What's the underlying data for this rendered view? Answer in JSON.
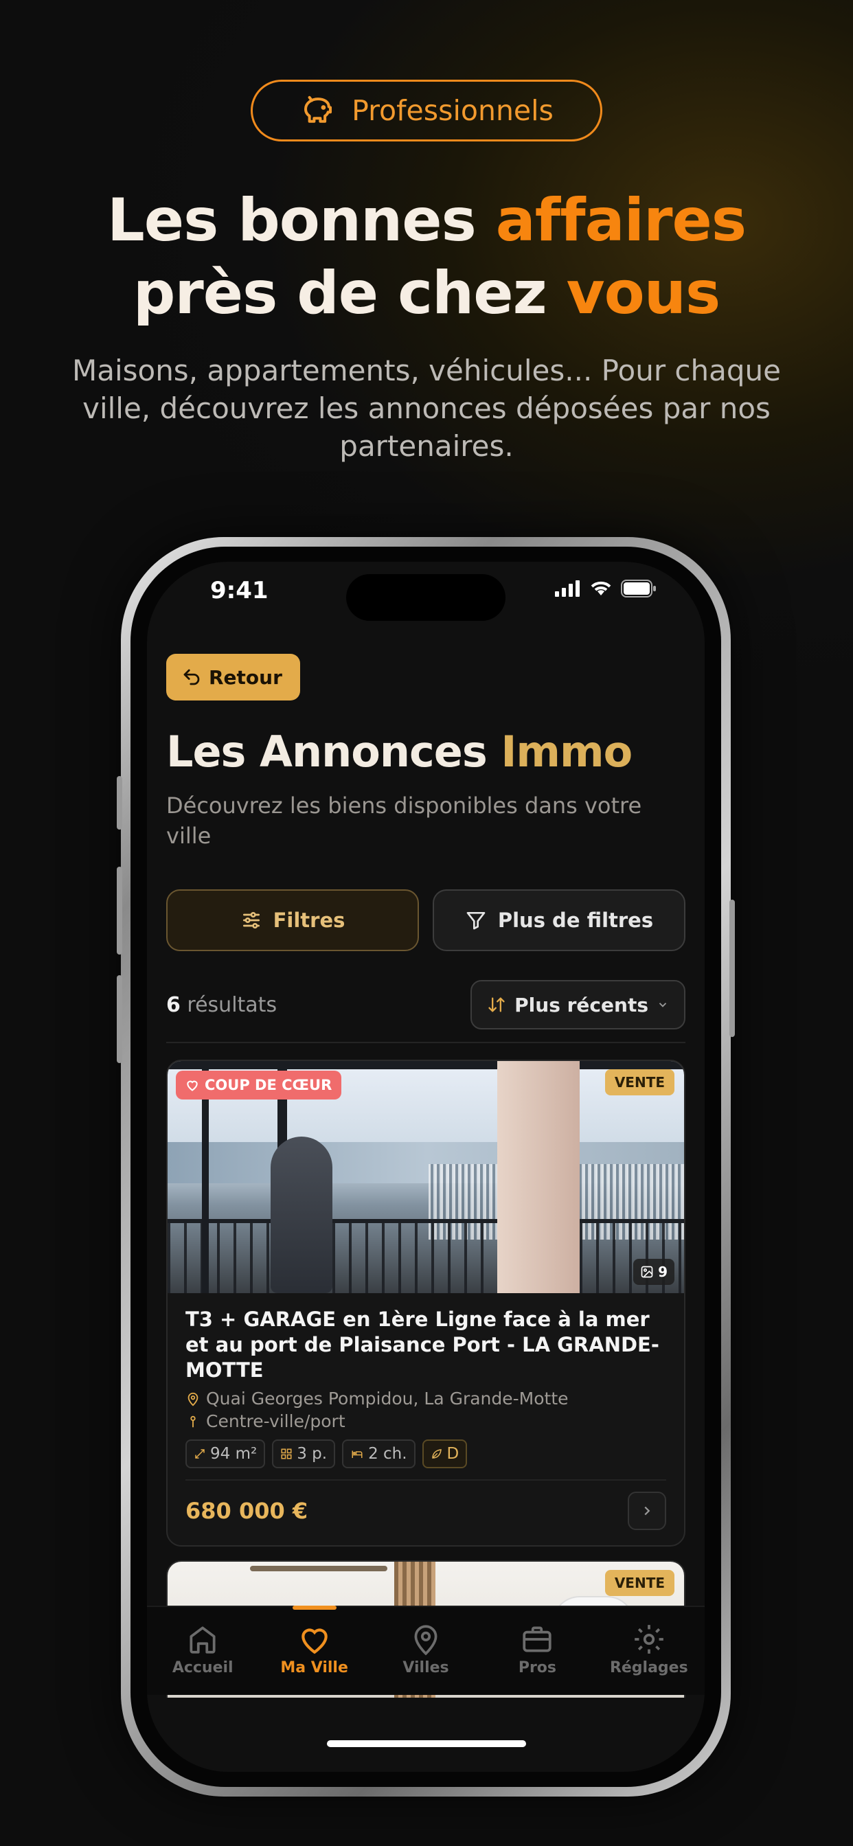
{
  "promo": {
    "badge_label": "Professionnels",
    "headline_part1": "Les bonnes ",
    "headline_accent1": "affaires",
    "headline_part2": "près de chez ",
    "headline_accent2": "vous",
    "subtitle": "Maisons, appartements, véhicules... Pour chaque ville, découvrez les annonces déposées par nos partenaires."
  },
  "status_bar": {
    "time": "9:41"
  },
  "header": {
    "back_label": "Retour",
    "title_main": "Les Annonces ",
    "title_accent": "Immo",
    "description": "Découvrez les biens disponibles dans votre ville"
  },
  "filters": {
    "filters_label": "Filtres",
    "more_filters_label": "Plus de filtres"
  },
  "results": {
    "count": "6",
    "count_suffix": "résultats",
    "sort_label": "Plus récents"
  },
  "listings": [
    {
      "favorite_label": "COUP DE CŒUR",
      "type_label": "VENTE",
      "photo_count": "9",
      "title": "T3 + GARAGE en 1ère Ligne face à la mer et au port de Plaisance Port - LA GRANDE-MOTTE",
      "address": "Quai Georges Pompidou, La Grande-Motte",
      "district": "Centre-ville/port",
      "surface": "94 m²",
      "rooms": "3 p.",
      "bedrooms": "2 ch.",
      "energy_class": "D",
      "price": "680 000 €"
    },
    {
      "type_label": "VENTE"
    }
  ],
  "tabbar": {
    "items": [
      {
        "label": "Accueil",
        "icon": "home-icon"
      },
      {
        "label": "Ma Ville",
        "icon": "heart-icon",
        "active": true
      },
      {
        "label": "Villes",
        "icon": "map-pin-icon"
      },
      {
        "label": "Pros",
        "icon": "briefcase-icon"
      },
      {
        "label": "Réglages",
        "icon": "gear-icon"
      }
    ]
  },
  "colors": {
    "accent_orange": "#f7850f",
    "gold": "#e3ab4a",
    "favorite_red": "#f06c6c"
  }
}
